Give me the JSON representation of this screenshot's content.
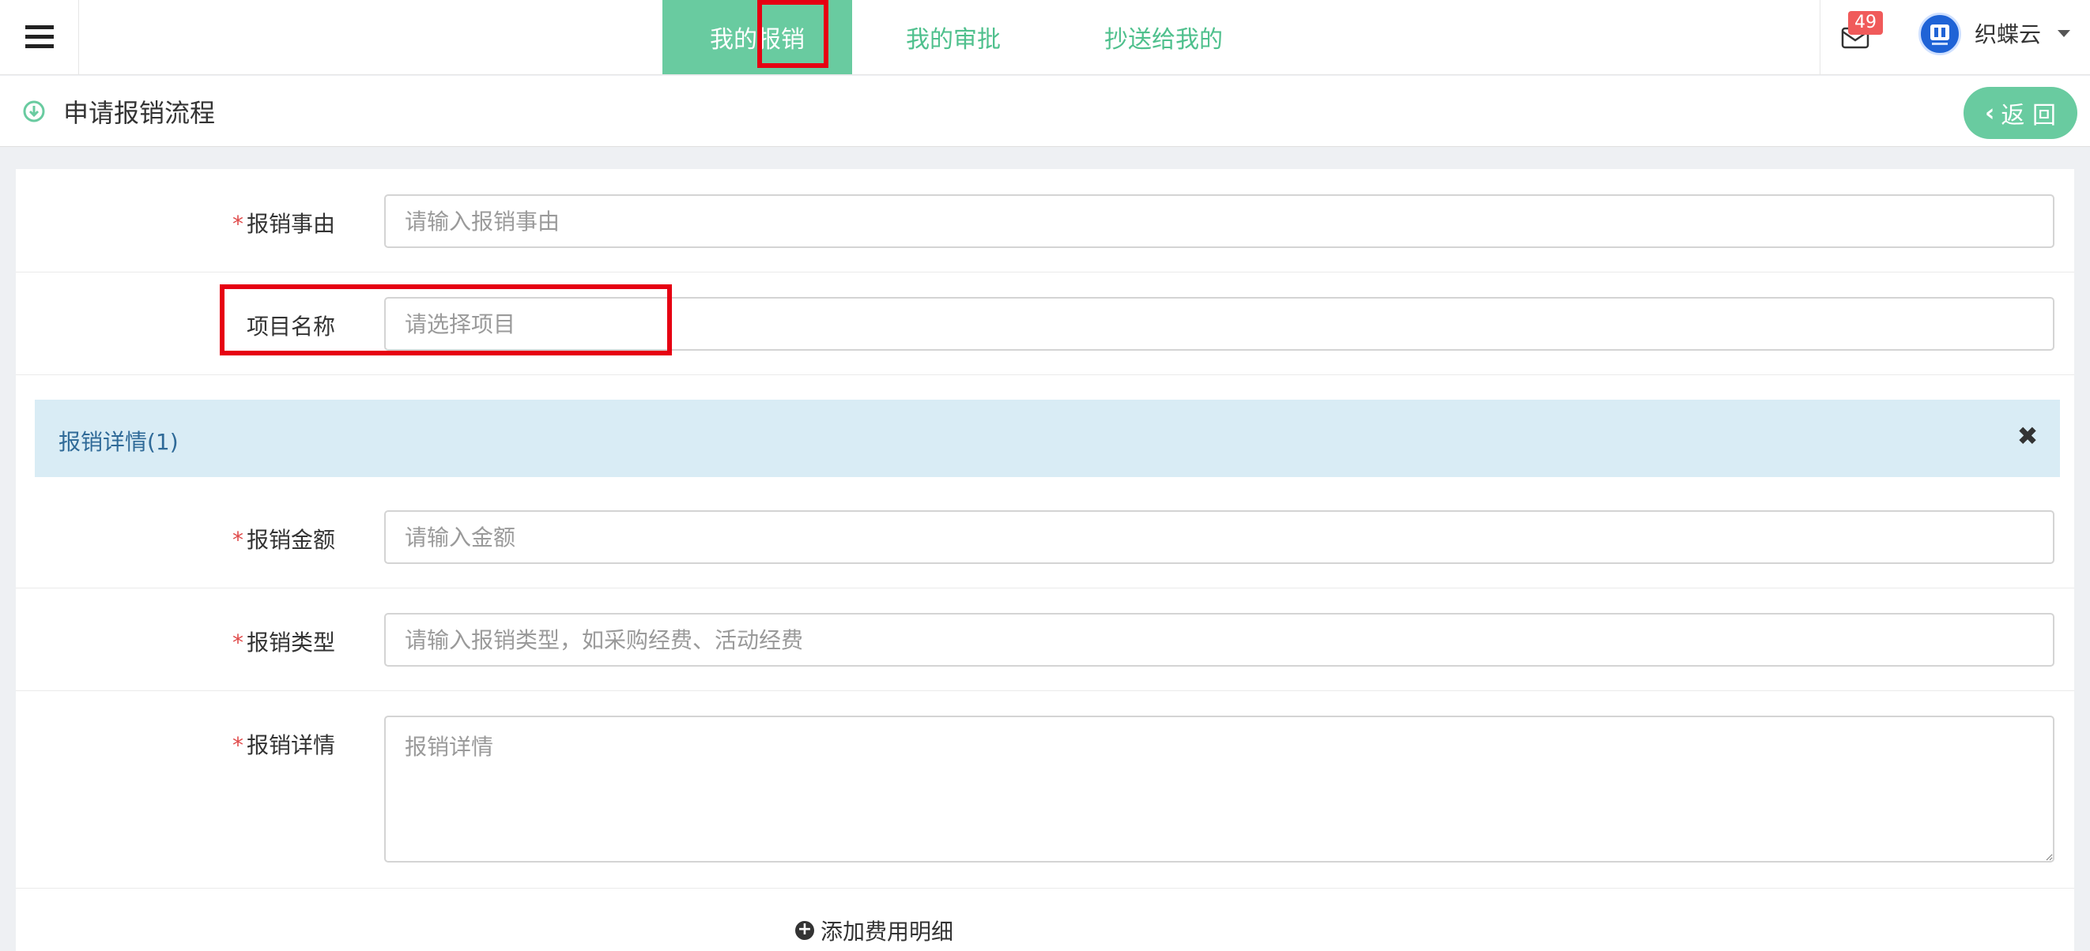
{
  "nav": {
    "tabs": [
      {
        "label": "我的报销",
        "active": true
      },
      {
        "label": "我的审批",
        "active": false
      },
      {
        "label": "抄送给我的",
        "active": false
      }
    ],
    "mail_badge": "49",
    "user_name": "织蝶云",
    "avatar_text": "织蝶云"
  },
  "page": {
    "title": "申请报销流程",
    "back_label": "返 回"
  },
  "form": {
    "reason": {
      "label": "报销事由",
      "placeholder": "请输入报销事由",
      "required": "*"
    },
    "project": {
      "label": "项目名称",
      "placeholder": "请选择项目"
    },
    "detail_section": {
      "title": "报销详情(1)",
      "close": "✖"
    },
    "amount": {
      "label": "报销金额",
      "placeholder": "请输入金额",
      "required": "*"
    },
    "type": {
      "label": "报销类型",
      "placeholder": "请输入报销类型，如采购经费、活动经费",
      "required": "*"
    },
    "details": {
      "label": "报销详情",
      "placeholder": "报销详情",
      "required": "*"
    },
    "add_item": "添加费用明细"
  },
  "colors": {
    "accent": "#69cba0",
    "tab_text": "#4fc08d",
    "detail_bg": "#d9ecf5",
    "highlight": "#e60012",
    "badge": "#f05a5a"
  }
}
